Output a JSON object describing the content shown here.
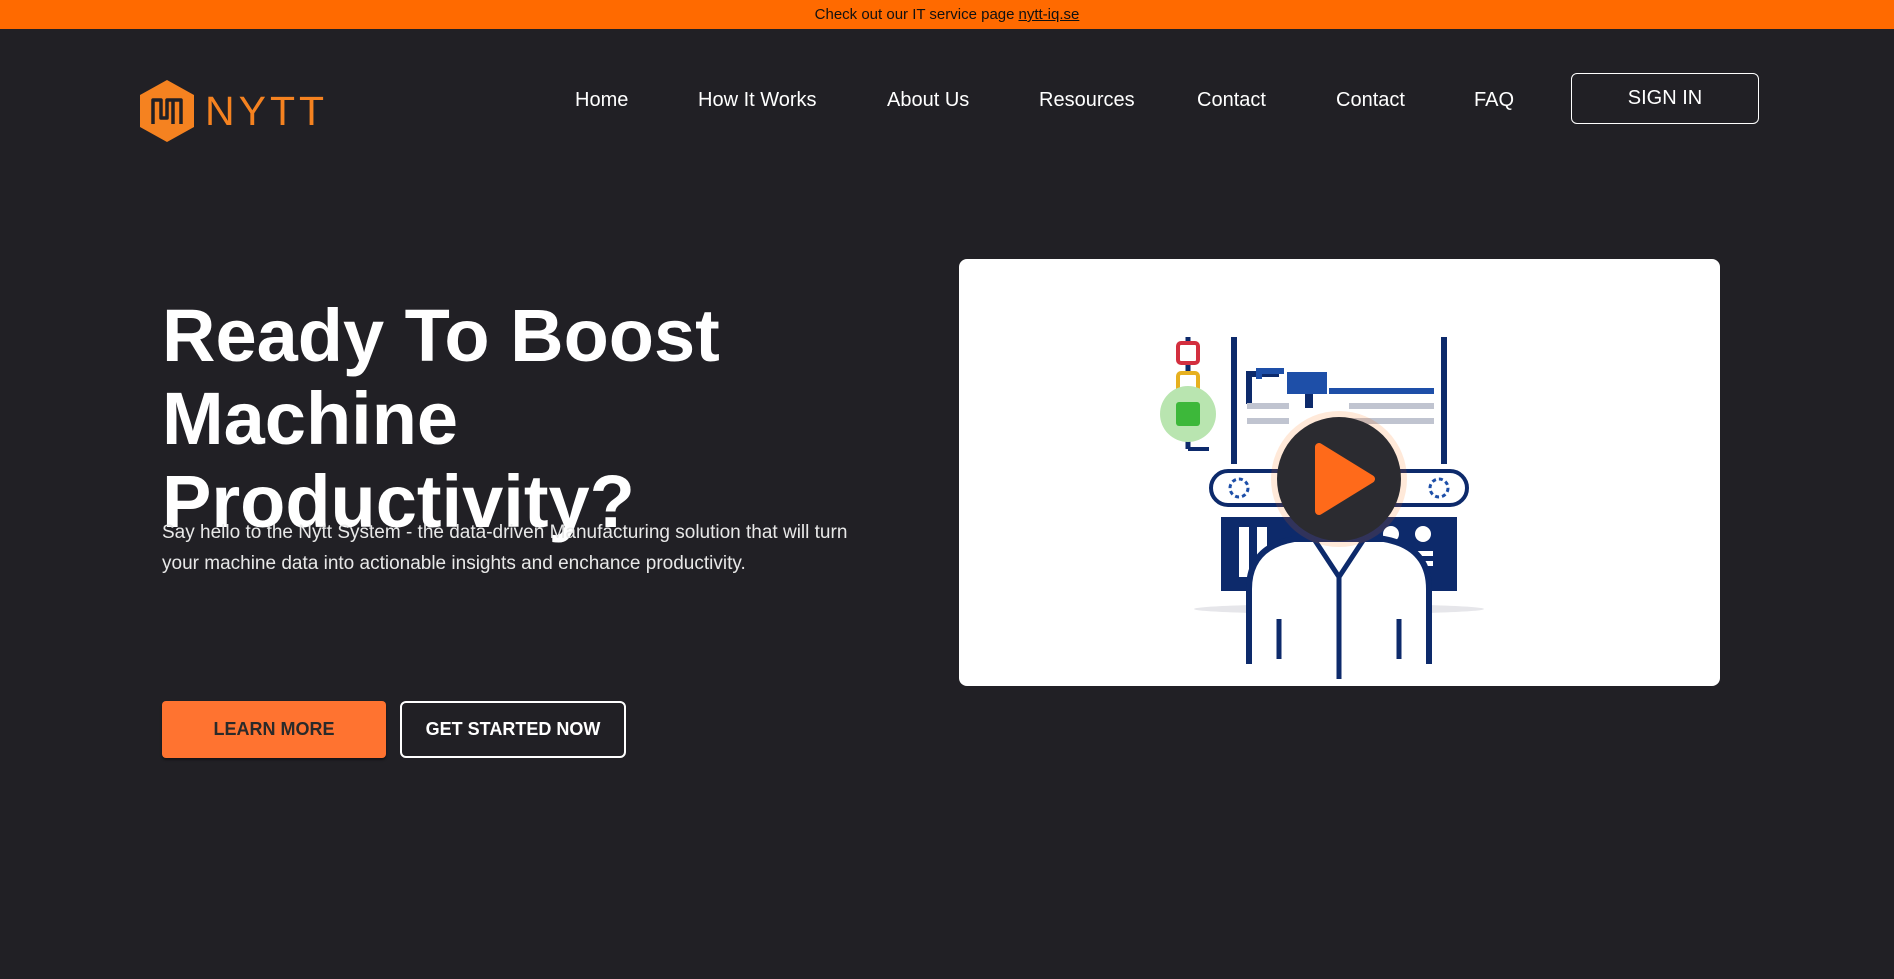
{
  "announcement": {
    "text": "Check out our IT service page",
    "link_text": "nytt-iq.se"
  },
  "brand": {
    "name": "NYTT",
    "accent_color": "#f58220"
  },
  "nav": {
    "items": [
      {
        "label": "Home"
      },
      {
        "label": "How It Works"
      },
      {
        "label": "About Us"
      },
      {
        "label": "Resources"
      },
      {
        "label": "Contact"
      },
      {
        "label": "Contact"
      },
      {
        "label": "FAQ"
      }
    ],
    "signin_label": "SIGN IN"
  },
  "hero": {
    "headline_line1": "Ready To Boost",
    "headline_line2": "Machine Productivity?",
    "subtext": "Say hello to the Nytt System - the data-driven Manufacturing solution that will turn your machine data into actionable insights and enchance productivity.",
    "learn_more_label": "LEARN MORE",
    "get_started_label": "GET STARTED NOW"
  },
  "video": {
    "icon": "play-icon",
    "illustration": "machine-operator-illustration"
  },
  "colors": {
    "background": "#212025",
    "announcement_bar": "#ff6a00",
    "primary_button": "#ff7330",
    "illustration_navy": "#0d2a6b"
  }
}
